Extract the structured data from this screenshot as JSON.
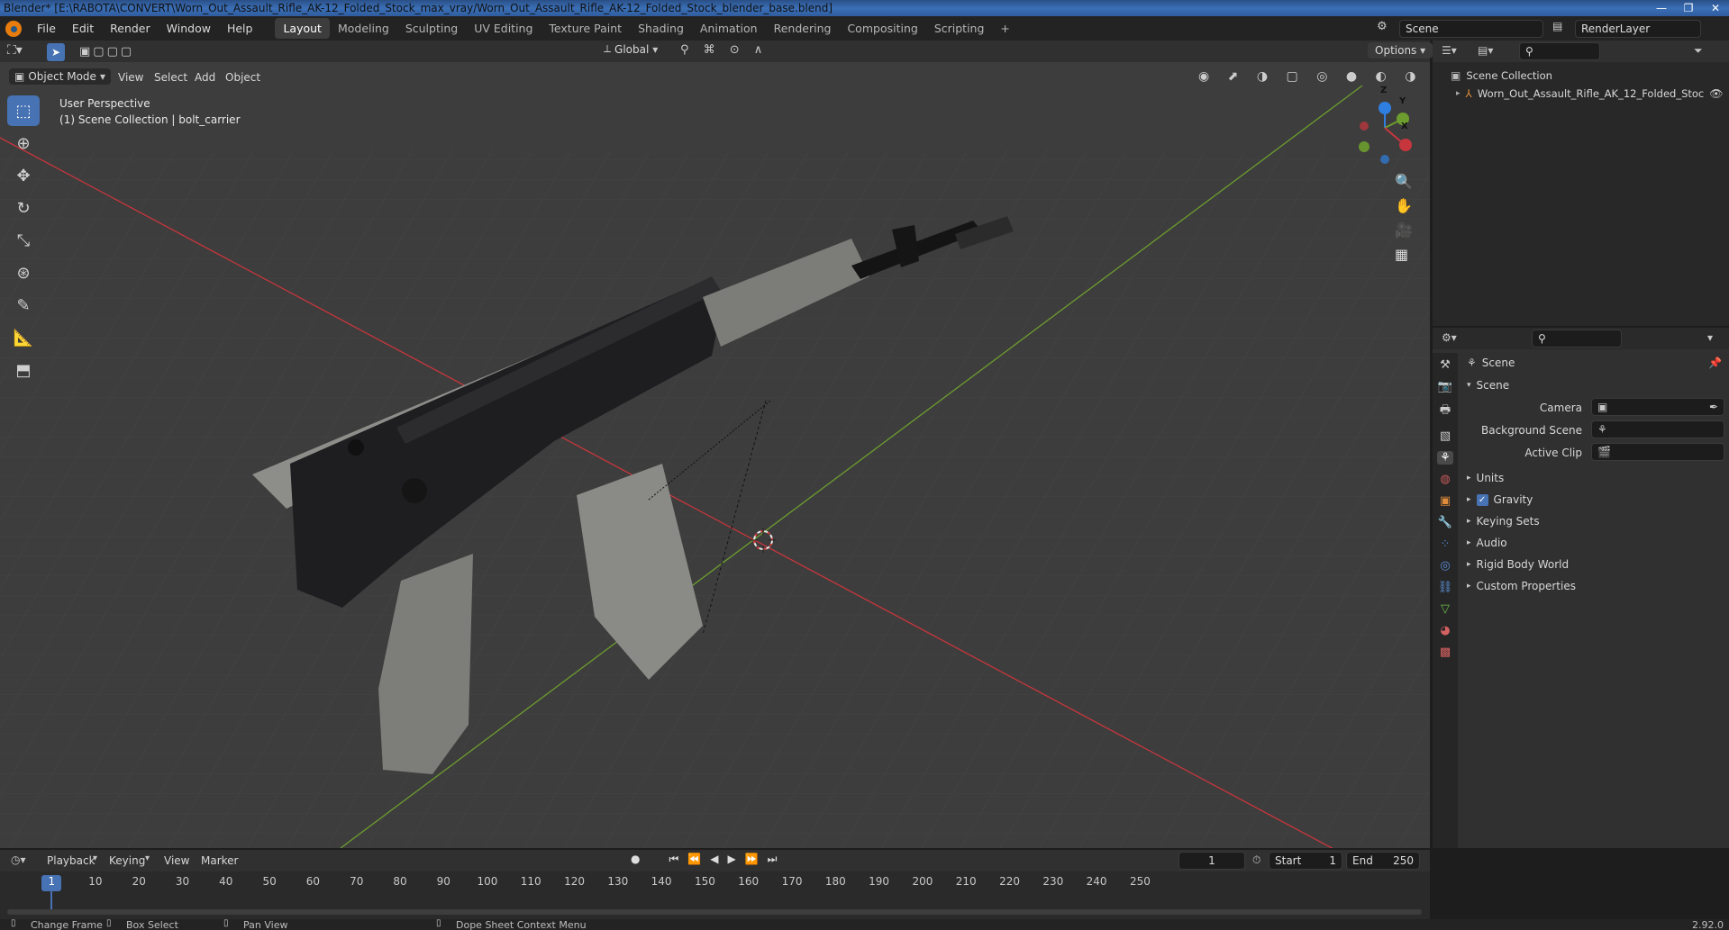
{
  "window": {
    "title": "Blender* [E:\\RABOTA\\CONVERT\\Worn_Out_Assault_Rifle_AK-12_Folded_Stock_max_vray/Worn_Out_Assault_Rifle_AK-12_Folded_Stock_blender_base.blend]",
    "buttons": [
      "—",
      "❐",
      "✕"
    ]
  },
  "menu": {
    "items": [
      "File",
      "Edit",
      "Render",
      "Window",
      "Help"
    ],
    "workspaces": [
      "Layout",
      "Modeling",
      "Sculpting",
      "UV Editing",
      "Texture Paint",
      "Shading",
      "Animation",
      "Rendering",
      "Compositing",
      "Scripting"
    ],
    "active_workspace": "Layout",
    "add_tab": "+",
    "scene_name": "Scene",
    "render_layer": "RenderLayer"
  },
  "viewport_header": {
    "transform_orientation": "Global",
    "options": "Options",
    "mode": "Object Mode",
    "menus": [
      "View",
      "Select",
      "Add",
      "Object"
    ]
  },
  "viewport": {
    "perspective": "User Perspective",
    "collection_info": "(1) Scene Collection | bolt_carrier",
    "gizmo": {
      "x": "X",
      "y": "Y",
      "z": "Z"
    }
  },
  "outliner": {
    "root": "Scene Collection",
    "items": [
      "Worn_Out_Assault_Rifle_AK_12_Folded_Stoc"
    ]
  },
  "properties": {
    "context": "Scene",
    "section": "Scene",
    "fields": {
      "camera_label": "Camera",
      "background_label": "Background Scene",
      "clip_label": "Active Clip"
    },
    "panels": [
      "Units",
      "Gravity",
      "Keying Sets",
      "Audio",
      "Rigid Body World",
      "Custom Properties"
    ],
    "gravity_checked": true
  },
  "timeline": {
    "menus": [
      "Playback",
      "Keying",
      "View",
      "Marker"
    ],
    "current_frame": "1",
    "start_label": "Start",
    "start": "1",
    "end_label": "End",
    "end": "250",
    "ticks": [
      "1",
      "10",
      "20",
      "30",
      "40",
      "50",
      "60",
      "70",
      "80",
      "90",
      "100",
      "110",
      "120",
      "130",
      "140",
      "150",
      "160",
      "170",
      "180",
      "190",
      "200",
      "210",
      "220",
      "230",
      "240",
      "250"
    ]
  },
  "statusbar": {
    "items": [
      "Change Frame",
      "Box Select",
      "Pan View",
      "Dope Sheet Context Menu"
    ],
    "version": "2.92.0"
  },
  "colors": {
    "accent": "#4772b3",
    "x_axis": "#c8363d",
    "y_axis": "#6d9d2e",
    "z_axis": "#2f7fe0"
  }
}
